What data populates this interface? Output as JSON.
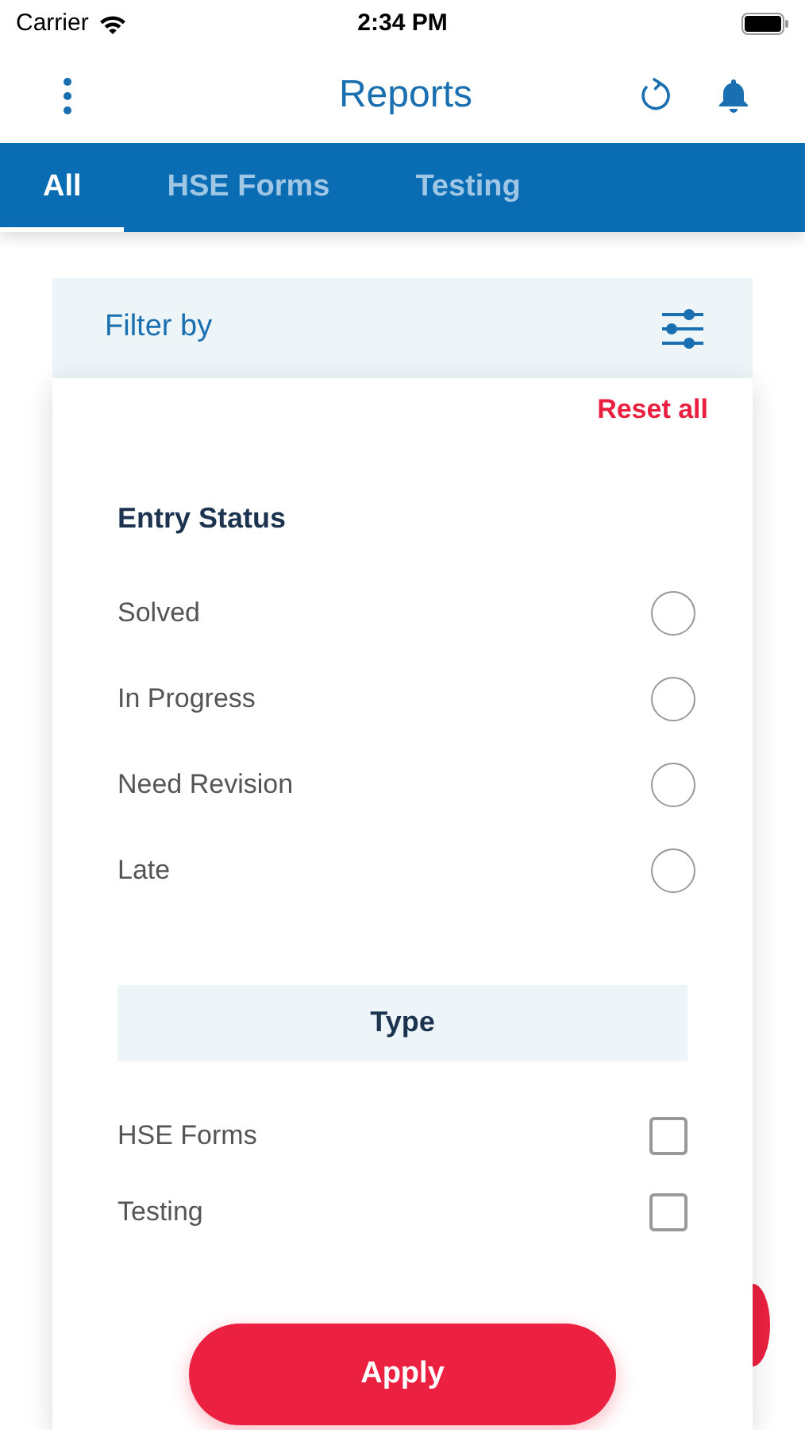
{
  "status_bar": {
    "carrier": "Carrier",
    "time": "2:34 PM"
  },
  "header": {
    "title": "Reports"
  },
  "tabs": [
    {
      "label": "All",
      "selected": true
    },
    {
      "label": "HSE Forms",
      "selected": false
    },
    {
      "label": "Testing",
      "selected": false
    }
  ],
  "filter": {
    "title": "Filter by",
    "reset": "Reset all",
    "entry_status": {
      "heading": "Entry Status",
      "options": [
        {
          "label": "Solved",
          "selected": false
        },
        {
          "label": "In Progress",
          "selected": false
        },
        {
          "label": "Need Revision",
          "selected": false
        },
        {
          "label": "Late",
          "selected": false
        }
      ]
    },
    "type": {
      "heading": "Type",
      "options": [
        {
          "label": "HSE Forms",
          "checked": false
        },
        {
          "label": "Testing",
          "checked": false
        }
      ]
    },
    "apply": "Apply"
  }
}
